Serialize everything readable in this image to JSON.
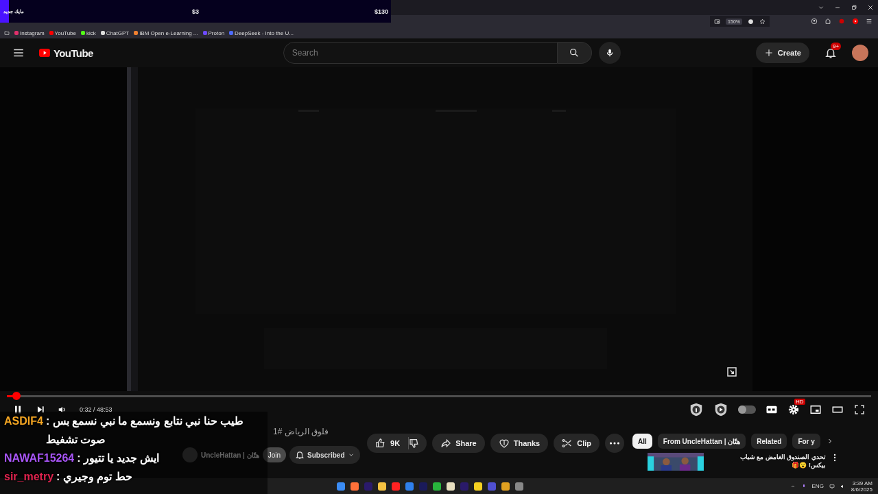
{
  "donation_goal": {
    "label": "مايك جديد",
    "current": "$3",
    "target": "$130",
    "level": 0.023
  },
  "browser": {
    "zoom": "150%",
    "bookmarks": [
      {
        "label": "Instagram",
        "color": "#e1306c"
      },
      {
        "label": "YouTube",
        "color": "#ff0000"
      },
      {
        "label": "kick",
        "color": "#53fc18"
      },
      {
        "label": "ChatGPT",
        "color": "#dddddd"
      },
      {
        "label": "IBM Open e-Learning ...",
        "color": "#f08030"
      },
      {
        "label": "Proton",
        "color": "#6d4aff"
      },
      {
        "label": "DeepSeek - Into the U...",
        "color": "#4d6bfe"
      }
    ]
  },
  "header": {
    "logo": "YouTube",
    "search_placeholder": "Search",
    "create": "Create",
    "notifications": "9+"
  },
  "player": {
    "progress": {
      "level": 0.011
    },
    "playing": true,
    "time": "0:32 / 48:53",
    "autoplay": false,
    "quality_badge": "HD"
  },
  "video": {
    "title": "فلوق الرياض #1",
    "channel": "UncleHattan | هتّان",
    "join": "Join",
    "subscribe": "Subscribed",
    "likes": "9K",
    "actions": [
      "Share",
      "Thanks",
      "Clip"
    ]
  },
  "chips": [
    {
      "label": "All",
      "selected": true
    },
    {
      "label": "From UncleHattan | هتّان",
      "selected": false
    },
    {
      "label": "Related",
      "selected": false
    },
    {
      "label": "For y",
      "selected": false
    }
  ],
  "recommendation": {
    "title": "تحدي الصندوق الغامض مع شباب بيكس!",
    "emoji": "😮🎁"
  },
  "chat": [
    {
      "user": "ASDIF4",
      "color": "#f5a623",
      "message": ": طيب حنا نبي نتابع ونسمع ما نبي نسمع بس صوت تشفيط"
    },
    {
      "user": "NAWAF15264",
      "color": "#a855f7",
      "message": ": ايش جديد يا تتيور"
    },
    {
      "user": "sir_metry",
      "color": "#e0234e",
      "message": ": حط توم وجيري"
    }
  ],
  "taskbar": {
    "language": "ENG",
    "time": "3:39 AM",
    "date": "8/6/2025"
  }
}
